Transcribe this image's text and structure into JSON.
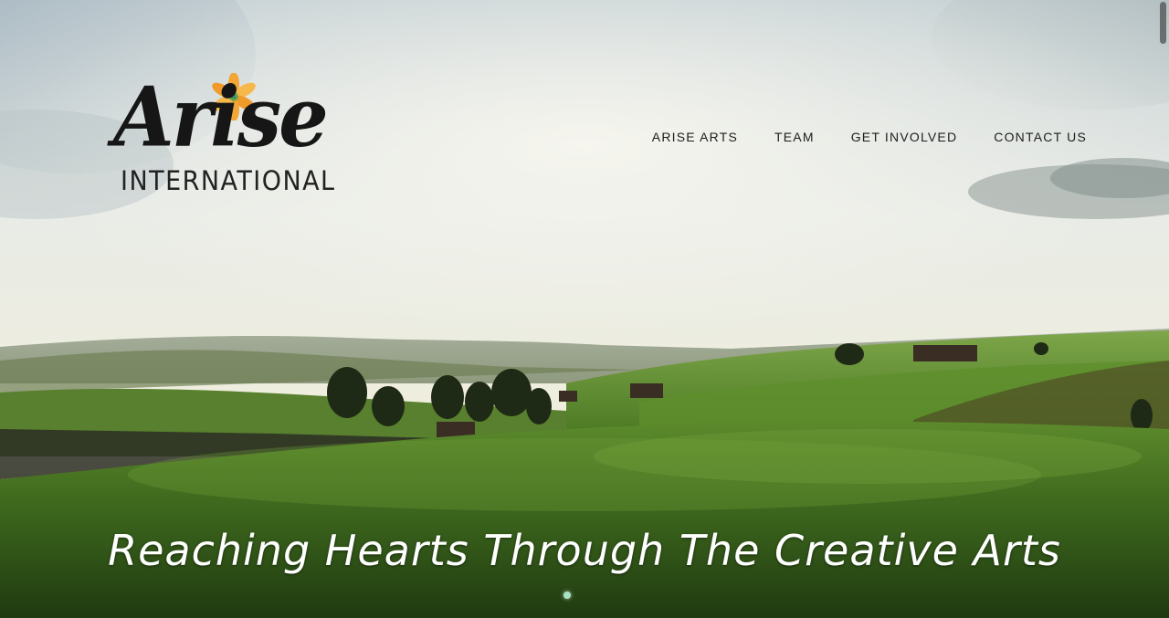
{
  "brand": {
    "logo_word": "Arise",
    "logo_sub": "INTERNATIONAL",
    "flower_color": "#f3a536"
  },
  "nav": {
    "items": [
      {
        "label": "ARISE ARTS"
      },
      {
        "label": "TEAM"
      },
      {
        "label": "GET INVOLVED"
      },
      {
        "label": "CONTACT US"
      }
    ]
  },
  "hero": {
    "tagline": "Reaching Hearts Through The Creative Arts",
    "slide_count": 1,
    "active_slide": 1,
    "indicator_color": "#a7e4c6"
  },
  "icons": {
    "flower": "lily-flower-icon"
  }
}
